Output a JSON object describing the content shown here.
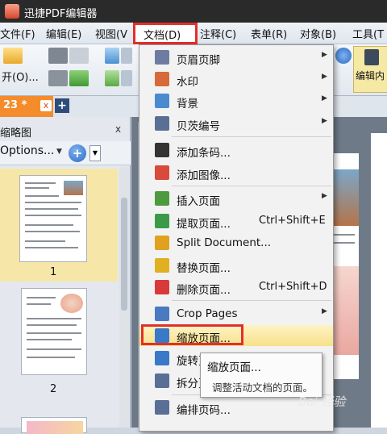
{
  "app": {
    "title": "迅捷PDF编辑器"
  },
  "menubar": {
    "items": [
      "文件(F)",
      "编辑(E)",
      "视图(V",
      "文档(D)",
      "注释(C)",
      "表单(R)",
      "对象(B)",
      "工具(T"
    ]
  },
  "toolbar": {
    "open_label": "开(O)...",
    "edit_label": "编辑内"
  },
  "tabs": {
    "doc_tab": "23 *",
    "close": "x",
    "new_tab": "+"
  },
  "thumbnails": {
    "title": "缩略图",
    "close": "x",
    "options_label": "Options...",
    "zoom_label": "+",
    "pages": [
      "1",
      "2"
    ]
  },
  "dropdown": {
    "items": [
      {
        "label": "页眉页脚",
        "shortcut": "",
        "submenu": true,
        "icon": "header-footer-icon",
        "color": "#6d7ca0"
      },
      {
        "label": "水印",
        "shortcut": "",
        "submenu": true,
        "icon": "watermark-icon",
        "color": "#d66a3a"
      },
      {
        "label": "背景",
        "shortcut": "",
        "submenu": true,
        "icon": "background-icon",
        "color": "#4a8bd0"
      },
      {
        "label": "贝茨编号",
        "shortcut": "",
        "submenu": true,
        "icon": "bates-number-icon",
        "color": "#5a6f96"
      },
      {
        "label": "添加条码...",
        "shortcut": "",
        "submenu": false,
        "icon": "barcode-icon",
        "color": "#333333"
      },
      {
        "label": "添加图像...",
        "shortcut": "",
        "submenu": false,
        "icon": "add-image-icon",
        "color": "#d84a3a"
      },
      {
        "label": "插入页面",
        "shortcut": "",
        "submenu": true,
        "icon": "insert-page-icon",
        "color": "#4e9a3e"
      },
      {
        "label": "提取页面...",
        "shortcut": "Ctrl+Shift+E",
        "submenu": false,
        "icon": "extract-page-icon",
        "color": "#3a9a4a"
      },
      {
        "label": "Split Document...",
        "shortcut": "",
        "submenu": false,
        "icon": "split-document-icon",
        "color": "#e0a020"
      },
      {
        "label": "替换页面...",
        "shortcut": "",
        "submenu": false,
        "icon": "replace-page-icon",
        "color": "#e0b020"
      },
      {
        "label": "删除页面...",
        "shortcut": "Ctrl+Shift+D",
        "submenu": false,
        "icon": "delete-page-icon",
        "color": "#d83a3a"
      },
      {
        "label": "Crop Pages",
        "shortcut": "",
        "submenu": true,
        "icon": "crop-pages-icon",
        "color": "#4a7ac0"
      },
      {
        "label": "缩放页面...",
        "shortcut": "",
        "submenu": false,
        "icon": "scale-page-icon",
        "color": "#3a78c8"
      },
      {
        "label": "旋转页",
        "shortcut": "",
        "submenu": false,
        "icon": "rotate-page-icon",
        "color": "#3a78c8"
      },
      {
        "label": "拆分页",
        "shortcut": "",
        "submenu": false,
        "icon": "split-page-icon",
        "color": "#5a6f96"
      },
      {
        "label": "编排页码...",
        "shortcut": "",
        "submenu": false,
        "icon": "number-pages-icon",
        "color": "#5a6f96"
      }
    ]
  },
  "tooltip": {
    "title": "缩放页面...",
    "description": "调整活动文档的页面。"
  },
  "watermark": "Bai 经验"
}
